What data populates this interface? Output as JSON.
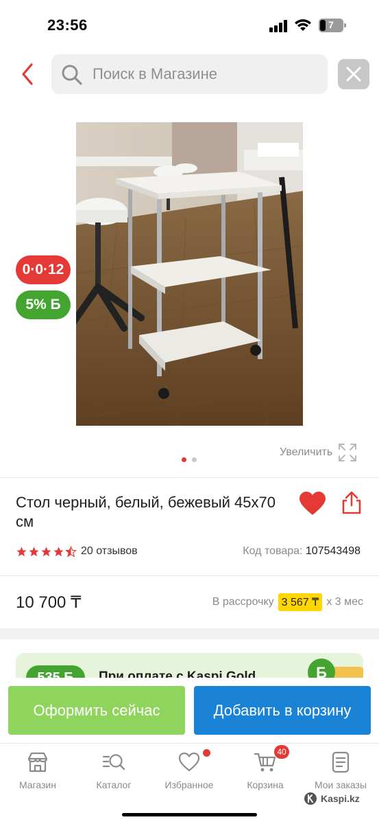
{
  "status_bar": {
    "time": "23:56",
    "battery": "7"
  },
  "search": {
    "placeholder": "Поиск в Магазине"
  },
  "badges": {
    "installment": "0·0·12",
    "bonus": "5% Б"
  },
  "gallery": {
    "zoom_label": "Увеличить",
    "current_page": 1,
    "total_pages": 2
  },
  "product": {
    "title": "Стол черный, белый, бежевый 45x70 см",
    "rating": 4.5,
    "reviews": "20 отзывов",
    "sku_label": "Код товара:",
    "sku": "107543498",
    "price": "10 700 ₸",
    "installment_prefix": "В рассрочку",
    "installment_amount": "3 567 ₸",
    "installment_term": "x 3 мес"
  },
  "promo": {
    "bonus": "535 Б",
    "text": "При оплате с Kaspi Gold"
  },
  "actions": {
    "buy_now": "Оформить сейчас",
    "add_to_cart": "Добавить в корзину"
  },
  "tabs": [
    {
      "label": "Магазин"
    },
    {
      "label": "Каталог"
    },
    {
      "label": "Избранное"
    },
    {
      "label": "Корзина",
      "badge": "40"
    },
    {
      "label": "Мои заказы"
    }
  ],
  "watermark": "Kaspi.kz",
  "colors": {
    "accent_red": "#e53935",
    "bonus_green": "#43a52f",
    "buy_button": "#8fd45d",
    "cart_button": "#1a83d6",
    "installment_highlight": "#ffd600"
  },
  "icons": [
    "back-arrow-icon",
    "search-icon",
    "close-icon",
    "heart-icon",
    "share-icon",
    "zoom-icon",
    "star-icon",
    "shop-icon",
    "catalog-icon",
    "favorites-icon",
    "cart-icon",
    "orders-icon"
  ]
}
